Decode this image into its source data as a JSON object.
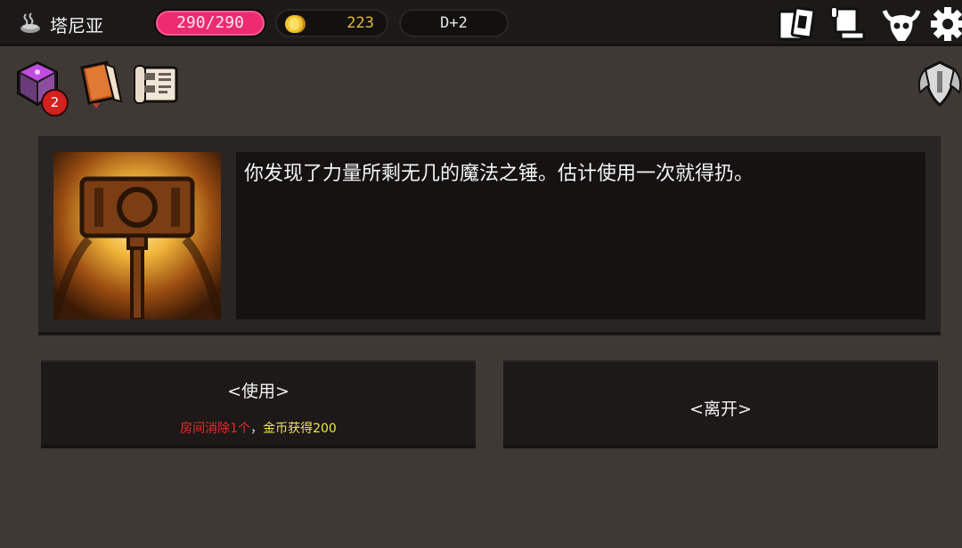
{
  "top_bar": {
    "location_name": "塔尼亚",
    "hp": "290/290",
    "gold": "223",
    "day": "D+2",
    "location_icon": "steaming-pot-icon",
    "coin_icon": "gold-coin-icon",
    "buttons": [
      "cards-icon",
      "map-scroll-icon",
      "monster-skull-icon",
      "gear-icon"
    ]
  },
  "inventory": {
    "items": [
      "purple-dice-icon",
      "spellbook-icon",
      "scroll-icon"
    ],
    "dice_count": "2",
    "right_item": "winged-shield-icon"
  },
  "event": {
    "image": "magic-hammer-icon",
    "text": "你发现了力量所剩无几的魔法之锤。估计使用一次就得扔。"
  },
  "choices": [
    {
      "label": "<使用>",
      "effect_negative": "房间消除1个",
      "effect_separator": "，",
      "effect_positive": "金币获得200"
    },
    {
      "label": "<离开>"
    }
  ],
  "colors": {
    "background": "#3f3935",
    "topbar": "#1c1a19",
    "hp_pill": "#ee2b70",
    "gold_text": "#e8b739",
    "negative_effect": "#f2282b",
    "positive_effect": "#f2e64a",
    "badge": "#d2211f"
  }
}
